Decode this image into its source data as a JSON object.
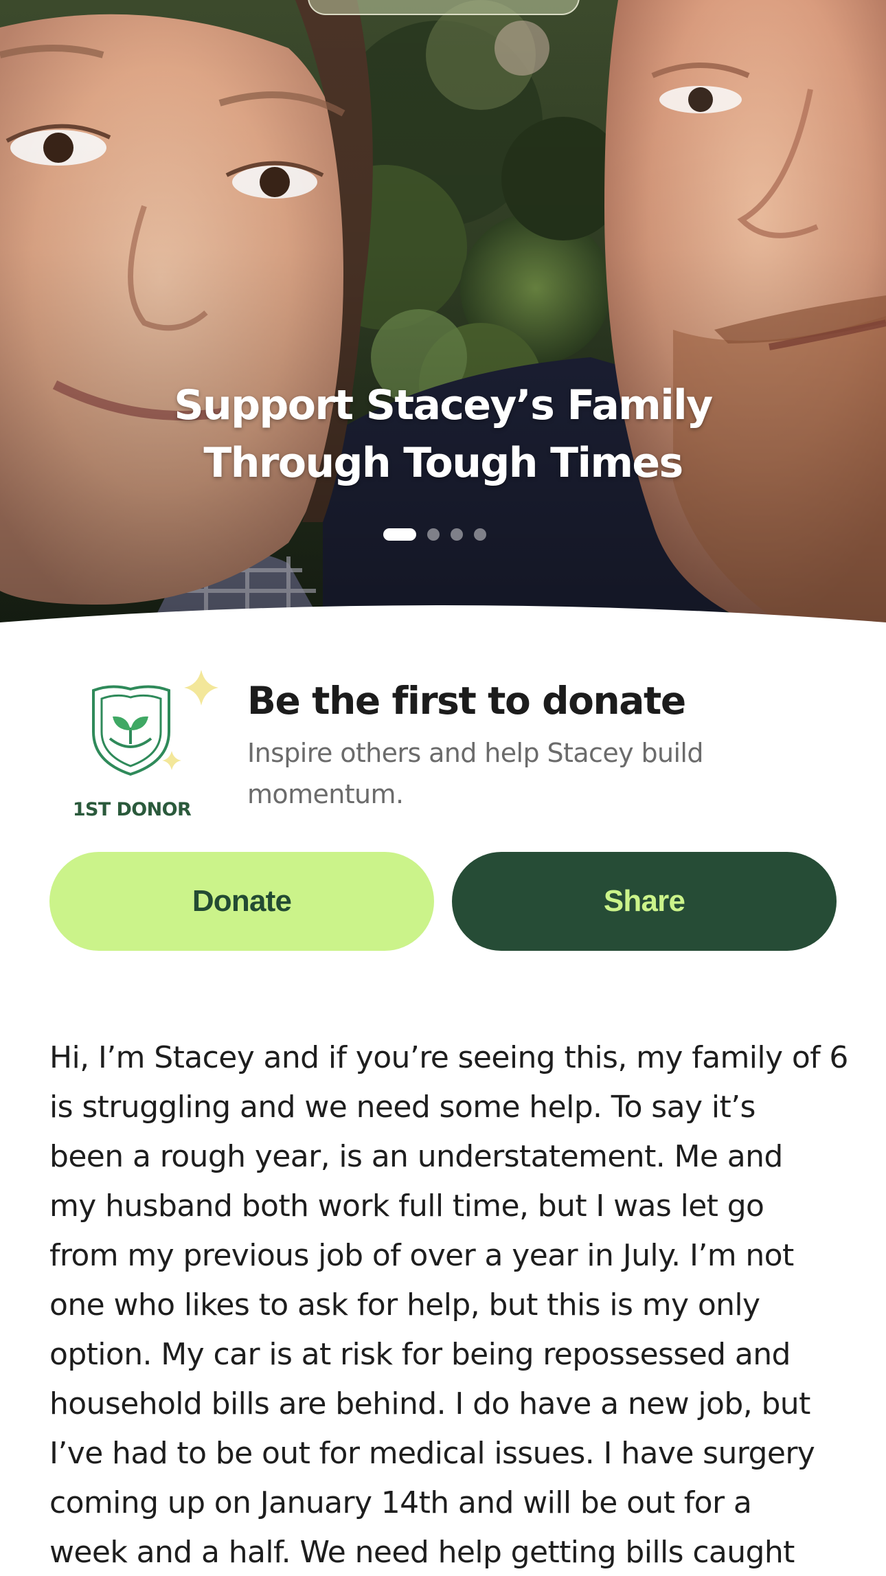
{
  "hero": {
    "title_line_1": "Support Stacey’s Family",
    "title_line_2": "Through Tough Times",
    "carousel_total": 4,
    "carousel_active": 1
  },
  "first_donor": {
    "badge_label": "1ST DONOR",
    "heading": "Be the first to donate",
    "subtext_line_1": "Inspire others and help Stacey build",
    "subtext_line_2": "momentum."
  },
  "actions": {
    "donate_label": "Donate",
    "share_label": "Share"
  },
  "story": {
    "lines": [
      "Hi, I’m Stacey and if you’re seeing this, my family of 6",
      "is struggling and we need some help. To say it’s",
      "been a rough year, is an understatement. Me and",
      "my husband both work full time, but I was let go",
      "from my previous job of over a year in July. I’m not",
      "one who likes to ask for help, but this is my only",
      "option. My car is at risk for being repossessed and",
      "household bills are behind. I do have a new job, but",
      "I’ve had to be out for medical issues. I have surgery",
      "coming up on January 14th and will be out for a",
      "week and a half. We need help getting bills caught"
    ]
  },
  "colors": {
    "accent_light_green": "#cbf38a",
    "accent_dark_green": "#264c36",
    "badge_green": "#2b5a3c",
    "sparkle_yellow": "#f3e79a"
  }
}
